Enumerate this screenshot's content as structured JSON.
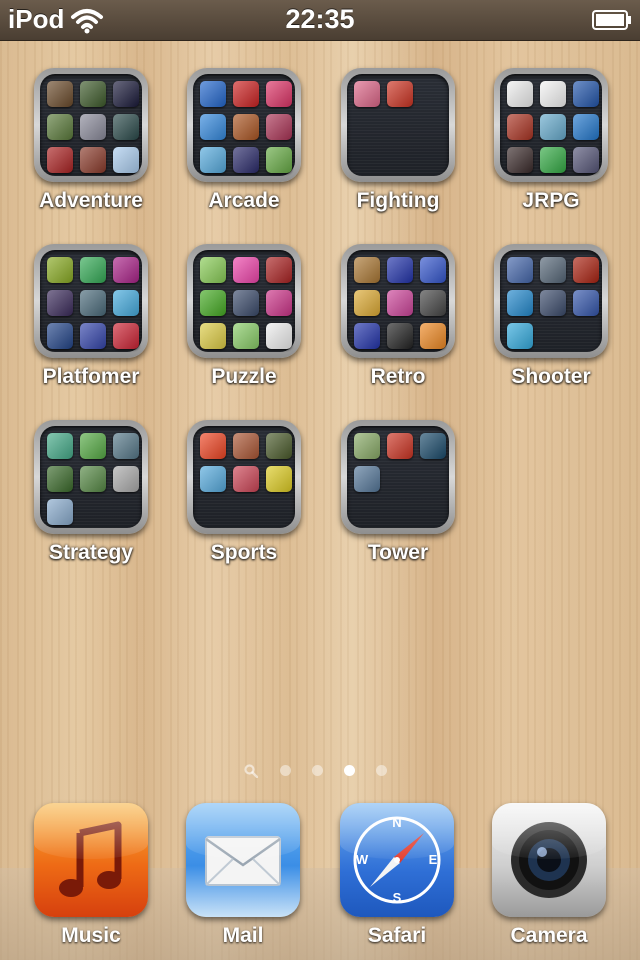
{
  "statusbar": {
    "carrier": "iPod",
    "time": "22:35",
    "wifi_icon": "wifi-icon",
    "battery_icon": "battery-icon"
  },
  "folders": [
    {
      "label": "Adventure",
      "colors": [
        "#6a4a2a",
        "#3d5a2a",
        "#1a1a3a",
        "#5a7a3a",
        "#8a8a9a",
        "#2a4a4a",
        "#aa2222",
        "#8a3a2a",
        "#aaccee"
      ]
    },
    {
      "label": "Arcade",
      "colors": [
        "#2266cc",
        "#cc2222",
        "#dd3366",
        "#3388dd",
        "#aa5522",
        "#aa3355",
        "#55aadd",
        "#2a2a6a",
        "#66aa44"
      ]
    },
    {
      "label": "Fighting",
      "colors": [
        "#dd6688",
        "#cc3322"
      ]
    },
    {
      "label": "JRPG",
      "colors": [
        "#eeeeee",
        "#f4f4f4",
        "#2255aa",
        "#aa3322",
        "#66aacc",
        "#2277cc",
        "#3a2a2a",
        "#33aa44",
        "#555577"
      ]
    },
    {
      "label": "Platfomer",
      "colors": [
        "#88aa22",
        "#33aa55",
        "#aa2288",
        "#3a2a5a",
        "#4a6a7a",
        "#44aadd",
        "#224488",
        "#3344aa",
        "#cc2233"
      ]
    },
    {
      "label": "Puzzle",
      "colors": [
        "#88cc55",
        "#ee44aa",
        "#aa2222",
        "#44aa22",
        "#3a4a6a",
        "#cc3388",
        "#ddcc44",
        "#88cc66",
        "#eeeeee"
      ]
    },
    {
      "label": "Retro",
      "colors": [
        "#aa7733",
        "#2233aa",
        "#3355cc",
        "#ddaa33",
        "#cc4499",
        "#444444",
        "#2233aa",
        "#222222",
        "#ee8822"
      ]
    },
    {
      "label": "Shooter",
      "colors": [
        "#4466aa",
        "#556677",
        "#aa2211",
        "#2288cc",
        "#3a4a6a",
        "#3355aa",
        "#33aadd"
      ]
    },
    {
      "label": "Strategy",
      "colors": [
        "#44aa88",
        "#55aa44",
        "#557788",
        "#3a6a2a",
        "#558844",
        "#aaaaaa",
        "#88aacc"
      ]
    },
    {
      "label": "Sports",
      "colors": [
        "#ee4422",
        "#aa5533",
        "#4a5a2a",
        "#55aadd",
        "#cc4455",
        "#ddcc22"
      ]
    },
    {
      "label": "Tower",
      "colors": [
        "#88aa66",
        "#cc3322",
        "#1a4a6a",
        "#557799"
      ]
    }
  ],
  "page_dots": {
    "count": 4,
    "active_index": 2,
    "search_icon": "search-icon"
  },
  "dock": [
    {
      "label": "Music",
      "icon": "music-icon",
      "color": "#ee5511"
    },
    {
      "label": "Mail",
      "icon": "mail-icon",
      "color": "#3b8ee6"
    },
    {
      "label": "Safari",
      "icon": "safari-icon",
      "color": "#2f6fd6"
    },
    {
      "label": "Camera",
      "icon": "camera-icon",
      "color": "#d8d8d8"
    }
  ]
}
